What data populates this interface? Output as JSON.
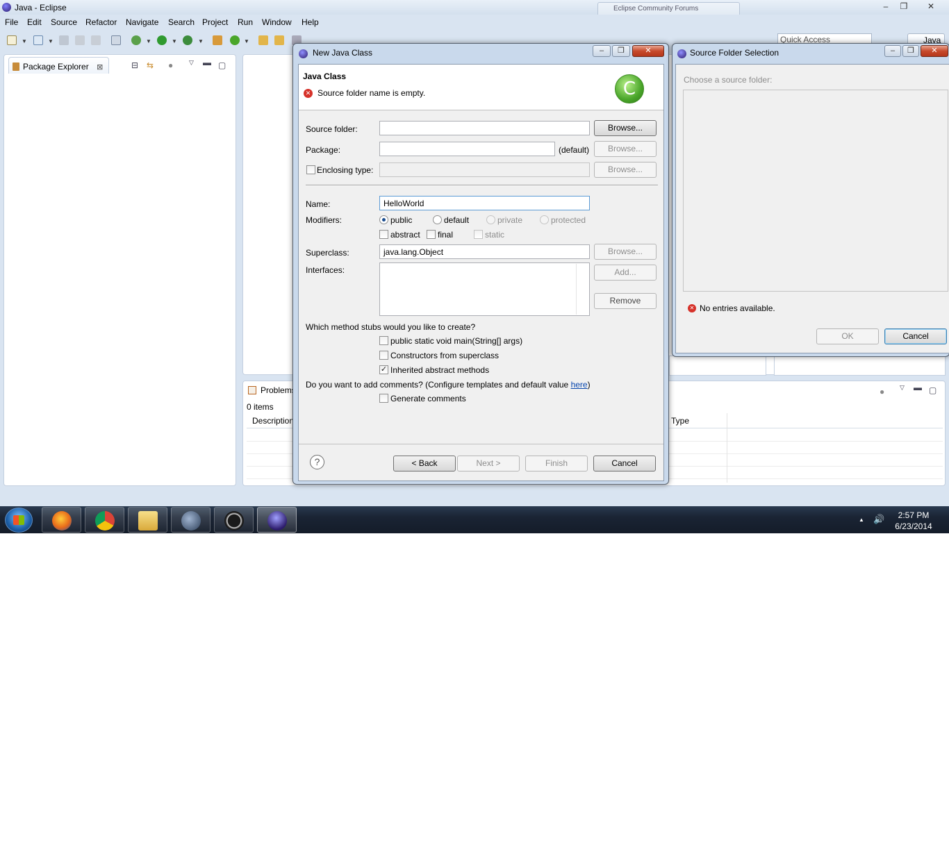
{
  "window": {
    "title": "Java - Eclipse",
    "background_tabs": [
      "Eclipse Community Forums"
    ],
    "controls": {
      "minimize": "–",
      "maximize": "❐",
      "close": "✕"
    }
  },
  "menubar": {
    "items": [
      "File",
      "Edit",
      "Source",
      "Refactor",
      "Navigate",
      "Search",
      "Project",
      "Run",
      "Window",
      "Help"
    ]
  },
  "toolbar": {
    "quick_access": "Quick Access",
    "perspective": "Java"
  },
  "package_explorer": {
    "tab_label": "Package Explorer",
    "close_glyph": "⊠"
  },
  "problems": {
    "tab_label": "Problems",
    "count": "0 items",
    "columns": [
      "Description",
      "Type"
    ]
  },
  "new_java_class": {
    "title": "New Java Class",
    "banner_title": "Java Class",
    "banner_error": "Source folder name is empty.",
    "logo_glyph": "C",
    "source_folder_label": "Source folder:",
    "source_folder_value": "",
    "package_label": "Package:",
    "package_value": "",
    "package_default": "(default)",
    "enclosing_label": "Enclosing type:",
    "enclosing_value": "",
    "browse": "Browse...",
    "name_label": "Name:",
    "name_value": "HelloWorld",
    "modifiers_label": "Modifiers:",
    "modifiers": [
      "public",
      "default",
      "private",
      "protected"
    ],
    "selected_modifier": "public",
    "extra_modifiers": [
      "abstract",
      "final",
      "static"
    ],
    "superclass_label": "Superclass:",
    "superclass_value": "java.lang.Object",
    "interfaces_label": "Interfaces:",
    "add": "Add...",
    "remove": "Remove",
    "stubs_question": "Which method stubs would you like to create?",
    "stubs": [
      {
        "label": "public static void main(String[] args)",
        "checked": false
      },
      {
        "label": "Constructors from superclass",
        "checked": false
      },
      {
        "label": "Inherited abstract methods",
        "checked": true
      }
    ],
    "comments_question_pre": "Do you want to add comments? (Configure templates and default value ",
    "comments_link": "here",
    "comments_question_post": ")",
    "generate_comments": "Generate comments",
    "check_mark": "✓",
    "help_glyph": "?",
    "back": "< Back",
    "next": "Next >",
    "finish": "Finish",
    "cancel": "Cancel"
  },
  "source_folder_selection": {
    "title": "Source Folder Selection",
    "prompt": "Choose a source folder:",
    "error": "No entries available.",
    "ok": "OK",
    "cancel": "Cancel"
  },
  "taskbar": {
    "time": "2:57 PM",
    "date": "6/23/2014",
    "apps": [
      "firefox-icon",
      "chrome-icon",
      "explorer-icon",
      "media-icon",
      "ccleaner-icon",
      "eclipse-icon"
    ],
    "tray_up": "▲",
    "tray_volume": "🔊"
  },
  "colors": {
    "eclipse_bg": "#d9e4f1",
    "dialog_frame": "#c9d9ec",
    "error_red": "#d6322a",
    "link_blue": "#0645ad",
    "taskbar": "#1a2434"
  }
}
